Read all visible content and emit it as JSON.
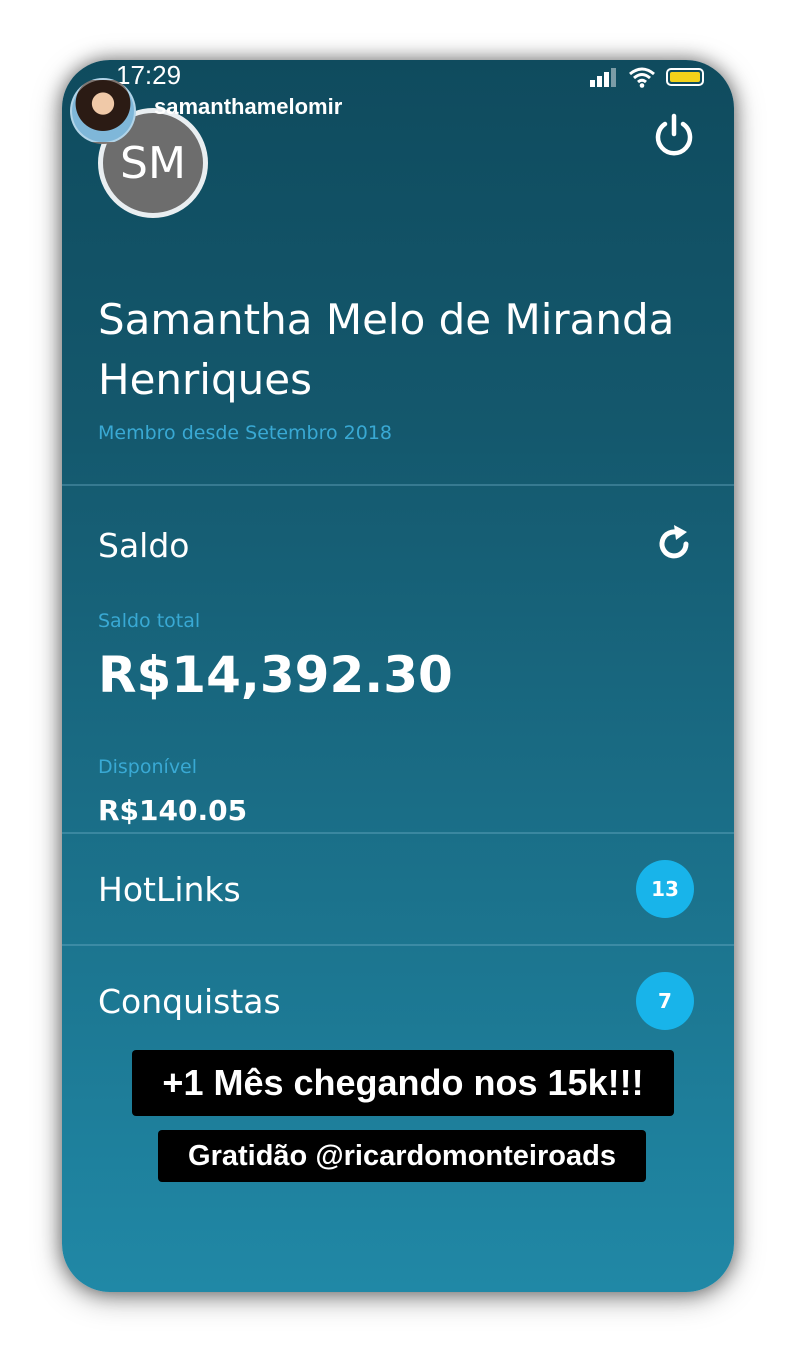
{
  "status_bar": {
    "time": "17:29",
    "icons": [
      "signal-icon",
      "wifi-icon",
      "battery-icon"
    ],
    "battery_color": "#f2d21a"
  },
  "story": {
    "username": "samanthamelomir"
  },
  "profile": {
    "initials": "SM",
    "name": "Samantha Melo de Miranda Henriques",
    "member_since": "Membro desde Setembro 2018"
  },
  "balance": {
    "title": "Saldo",
    "total_label": "Saldo total",
    "total_value": "R$14,392.30",
    "available_label": "Disponível",
    "available_value": "R$140.05"
  },
  "menu": [
    {
      "label": "HotLinks",
      "badge": "13"
    },
    {
      "label": "Conquistas",
      "badge": "7"
    }
  ],
  "captions": {
    "line1": "+1 Mês chegando nos 15k!!!",
    "line2": "Gratidão @ricardomonteiroads"
  },
  "colors": {
    "accent": "#39a9d4",
    "badge": "#18b4ea"
  }
}
